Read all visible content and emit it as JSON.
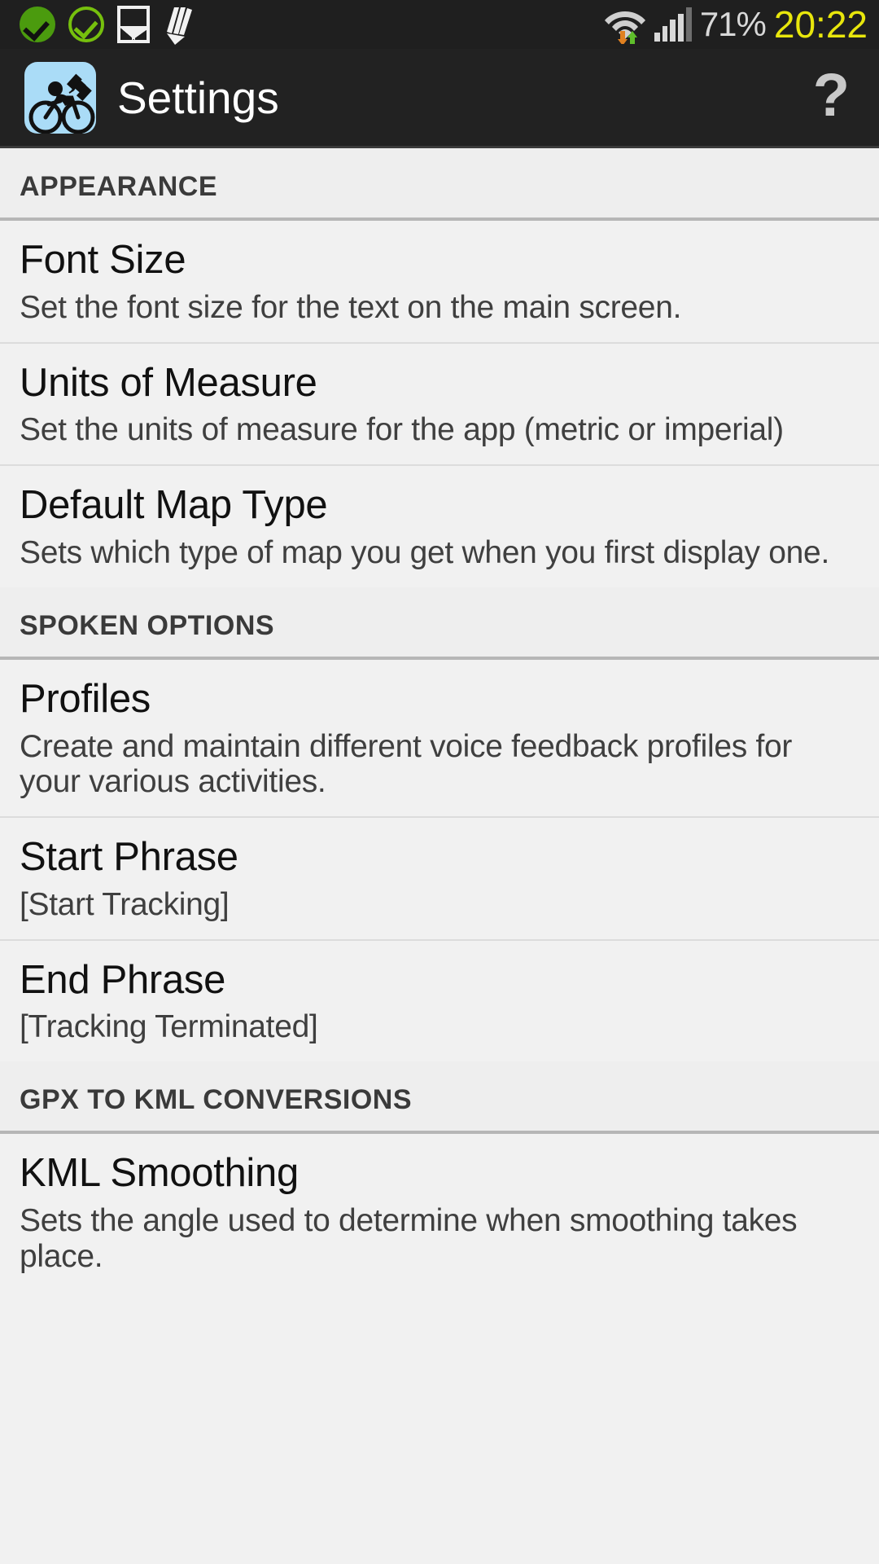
{
  "status_bar": {
    "icons_left": [
      "check-filled-icon",
      "check-outline-icon",
      "image-icon",
      "pencil-icon"
    ],
    "icons_right": [
      "wifi-transfer-icon",
      "cellular-signal-icon"
    ],
    "battery": "71%",
    "clock": "20:22",
    "colors": {
      "background": "#1f1f1f",
      "check_filled": "#4b9b0e",
      "check_outline": "#76c00d",
      "clock": "#e8e60c",
      "battery_text": "#d8d8d8",
      "upload_arrow": "#5fbf2b",
      "download_arrow": "#e08020"
    }
  },
  "action_bar": {
    "title": "Settings",
    "app_icon": "cyclist-satellite-icon",
    "help_label": "?",
    "colors": {
      "background": "#222222",
      "icon_background": "#aadcf7",
      "title": "#ffffff"
    }
  },
  "sections": [
    {
      "header": "APPEARANCE",
      "items": [
        {
          "title": "Font Size",
          "summary": "Set the font size for the text on the main screen."
        },
        {
          "title": "Units of Measure",
          "summary": "Set the units of measure for the app (metric or imperial)"
        },
        {
          "title": "Default Map Type",
          "summary": "Sets which type of map you get when you first display one."
        }
      ]
    },
    {
      "header": "SPOKEN OPTIONS",
      "items": [
        {
          "title": "Profiles",
          "summary": "Create and maintain different voice feedback profiles for your various activities."
        },
        {
          "title": "Start Phrase",
          "summary": "[Start Tracking]"
        },
        {
          "title": "End Phrase",
          "summary": "[Tracking Terminated]"
        }
      ]
    },
    {
      "header": "GPX TO KML CONVERSIONS",
      "items": [
        {
          "title": "KML Smoothing",
          "summary": "Sets the angle used to determine when smoothing takes place."
        }
      ]
    }
  ]
}
